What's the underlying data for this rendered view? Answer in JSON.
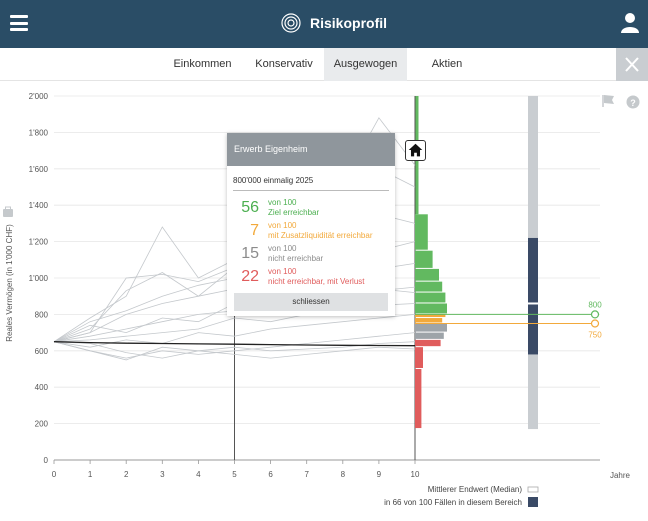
{
  "header": {
    "title": "Risikoprofil"
  },
  "tabs": [
    {
      "label": "Einkommen",
      "active": false
    },
    {
      "label": "Konservativ",
      "active": false
    },
    {
      "label": "Ausgewogen",
      "active": true
    },
    {
      "label": "Aktien",
      "active": false
    }
  ],
  "chart_data": {
    "type": "line",
    "ylabel": "Reales Vermögen (in 1'000 CHF)",
    "xlabel": "Jahre",
    "x_ticks": [
      "0",
      "1",
      "2",
      "3",
      "4",
      "5",
      "6",
      "7",
      "8",
      "9",
      "10"
    ],
    "y_ticks": [
      "0",
      "200",
      "400",
      "600",
      "800",
      "1'000",
      "1'200",
      "1'400",
      "1'600",
      "1'800",
      "2'000"
    ],
    "xlim": [
      0,
      10
    ],
    "ylim": [
      0,
      2000
    ],
    "median_line": {
      "x": [
        0,
        1,
        2,
        3,
        4,
        5,
        6,
        7,
        8,
        9,
        10
      ],
      "y": [
        650,
        645,
        642,
        640,
        638,
        636,
        634,
        632,
        630,
        629,
        628
      ]
    },
    "paths": [
      {
        "x": [
          0,
          1,
          2,
          3,
          4,
          5,
          6,
          7,
          8,
          9,
          10
        ],
        "y": [
          650,
          700,
          1000,
          1020,
          980,
          1060,
          1200,
          1400,
          1520,
          1880,
          1620
        ]
      },
      {
        "x": [
          0,
          1,
          2,
          3,
          4,
          5,
          6,
          7,
          8,
          9,
          10
        ],
        "y": [
          650,
          780,
          900,
          1280,
          1000,
          1100,
          1150,
          1300,
          1450,
          1600,
          1500
        ]
      },
      {
        "x": [
          0,
          1,
          2,
          3,
          4,
          5,
          6,
          7,
          8,
          9,
          10
        ],
        "y": [
          650,
          720,
          930,
          1030,
          900,
          1060,
          1100,
          980,
          1200,
          1350,
          1300
        ]
      },
      {
        "x": [
          0,
          1,
          2,
          3,
          4,
          5,
          6,
          7,
          8,
          9,
          10
        ],
        "y": [
          650,
          760,
          820,
          900,
          960,
          1000,
          960,
          1080,
          1120,
          1150,
          1200
        ]
      },
      {
        "x": [
          0,
          1,
          2,
          3,
          4,
          5,
          6,
          7,
          8,
          9,
          10
        ],
        "y": [
          650,
          700,
          800,
          860,
          900,
          940,
          920,
          980,
          1000,
          1050,
          1080
        ]
      },
      {
        "x": [
          0,
          1,
          2,
          3,
          4,
          5,
          6,
          7,
          8,
          9,
          10
        ],
        "y": [
          650,
          680,
          720,
          760,
          800,
          820,
          850,
          870,
          900,
          930,
          950
        ]
      },
      {
        "x": [
          0,
          1,
          2,
          3,
          4,
          5,
          6,
          7,
          8,
          9,
          10
        ],
        "y": [
          650,
          740,
          700,
          780,
          760,
          860,
          800,
          900,
          880,
          940,
          920
        ]
      },
      {
        "x": [
          0,
          1,
          2,
          3,
          4,
          5,
          6,
          7,
          8,
          9,
          10
        ],
        "y": [
          650,
          660,
          680,
          700,
          720,
          780,
          760,
          800,
          820,
          850,
          860
        ]
      },
      {
        "x": [
          0,
          1,
          2,
          3,
          4,
          5,
          6,
          7,
          8,
          9,
          10
        ],
        "y": [
          650,
          620,
          660,
          640,
          700,
          680,
          720,
          740,
          760,
          780,
          800
        ]
      },
      {
        "x": [
          0,
          1,
          2,
          3,
          4,
          5,
          6,
          7,
          8,
          9,
          10
        ],
        "y": [
          650,
          600,
          560,
          600,
          580,
          600,
          620,
          640,
          660,
          680,
          700
        ]
      },
      {
        "x": [
          0,
          1,
          2,
          3,
          4,
          5,
          6,
          7,
          8,
          9,
          10
        ],
        "y": [
          650,
          640,
          590,
          560,
          600,
          620,
          600,
          610,
          620,
          640,
          650
        ]
      },
      {
        "x": [
          0,
          1,
          2,
          3,
          4,
          5,
          6,
          7,
          8,
          9,
          10
        ],
        "y": [
          650,
          600,
          550,
          620,
          600,
          580,
          560,
          580,
          600,
          620,
          610
        ]
      }
    ],
    "histogram": [
      {
        "y0": 1150,
        "y1": 1350,
        "value": 8,
        "color": "#62b960"
      },
      {
        "y0": 1050,
        "y1": 1150,
        "value": 11,
        "color": "#62b960"
      },
      {
        "y0": 980,
        "y1": 1050,
        "value": 15,
        "color": "#62b960"
      },
      {
        "y0": 920,
        "y1": 980,
        "value": 17,
        "color": "#62b960"
      },
      {
        "y0": 860,
        "y1": 920,
        "value": 19,
        "color": "#62b960"
      },
      {
        "y0": 800,
        "y1": 860,
        "value": 20,
        "color": "#62b960"
      },
      {
        "y0": 780,
        "y1": 800,
        "value": 19,
        "color": "#f2a93b"
      },
      {
        "y0": 750,
        "y1": 780,
        "value": 17,
        "color": "#f2a93b"
      },
      {
        "y0": 700,
        "y1": 750,
        "value": 20,
        "color": "#9ea4a9"
      },
      {
        "y0": 660,
        "y1": 700,
        "value": 18,
        "color": "#9ea4a9"
      },
      {
        "y0": 620,
        "y1": 660,
        "value": 16,
        "color": "#e05c5c"
      },
      {
        "y0": 500,
        "y1": 620,
        "value": 5,
        "color": "#e05c5c"
      },
      {
        "y0": 170,
        "y1": 500,
        "value": 4,
        "color": "#e05c5c"
      }
    ],
    "goal_line": {
      "value": 800,
      "label": "800",
      "color": "#62b960"
    },
    "liquidity_line": {
      "value": 750,
      "label": "750",
      "color": "#f2a93b"
    },
    "range_bar": {
      "low": 170,
      "high": 2000,
      "band_low": 580,
      "band_high": 1220,
      "median": 860
    },
    "event_year": 5,
    "end_year": 10,
    "green_marker_top": 2000,
    "legend": [
      {
        "label": "Mittlerer Endwert (Median)"
      },
      {
        "label": "in 66 von 100 Fällen in diesem Bereich"
      }
    ]
  },
  "popup": {
    "title": "Erwerb Eigenheim",
    "subtitle": "800'000 einmalig 2025",
    "rows": [
      {
        "num": "56",
        "line1": "von 100",
        "line2": "Ziel erreichbar",
        "color": "#4caf50"
      },
      {
        "num": "7",
        "line1": "von 100",
        "line2": "mit Zusatzliquidität erreichbar",
        "color": "#f2a93b"
      },
      {
        "num": "15",
        "line1": "von 100",
        "line2": "nicht erreichbar",
        "color": "#8c8c8c"
      },
      {
        "num": "22",
        "line1": "von 100",
        "line2": "nicht erreichbar, mit Verlust",
        "color": "#e05c5c"
      }
    ],
    "button": "schliessen"
  },
  "colors": {
    "header": "#2a4d66",
    "green": "#62b960",
    "orange": "#f2a93b",
    "grey": "#9ea4a9",
    "red": "#e05c5c",
    "navy": "#3a4a66"
  },
  "icons": [
    "menu-icon",
    "target-icon",
    "user-icon",
    "close-icon",
    "flag-icon",
    "help-icon",
    "home-icon",
    "briefcase-icon"
  ]
}
